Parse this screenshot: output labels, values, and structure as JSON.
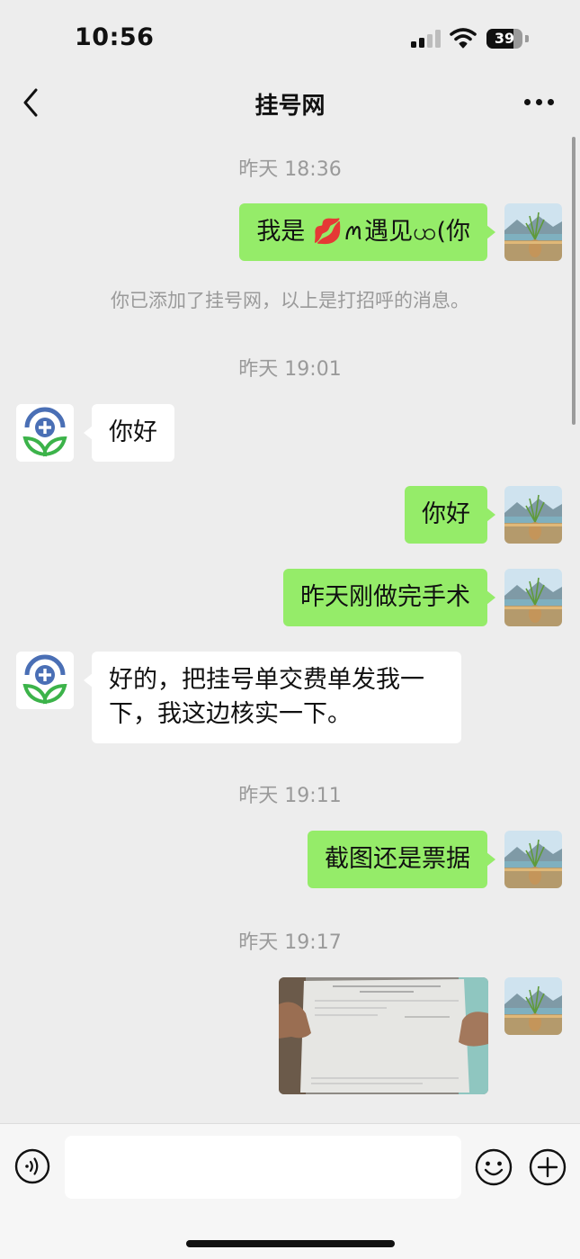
{
  "status_bar": {
    "time": "10:56",
    "battery": "39"
  },
  "nav": {
    "title": "挂号网"
  },
  "messages": [
    {
      "type": "timestamp",
      "text": "昨天 18:36"
    },
    {
      "type": "sent",
      "text": "我是 💋ꪔ遇见ꩤ(你"
    },
    {
      "type": "system",
      "text": "你已添加了挂号网，以上是打招呼的消息。"
    },
    {
      "type": "timestamp",
      "text": "昨天 19:01"
    },
    {
      "type": "received",
      "text": "你好"
    },
    {
      "type": "sent",
      "text": "你好"
    },
    {
      "type": "sent",
      "text": "昨天刚做完手术"
    },
    {
      "type": "received",
      "lines": [
        "好的，把挂号单交费单发我一",
        "下，我这边核实一下。"
      ]
    },
    {
      "type": "timestamp",
      "text": "昨天 19:11"
    },
    {
      "type": "sent",
      "text": "截图还是票据"
    },
    {
      "type": "timestamp",
      "text": "昨天 19:17"
    },
    {
      "type": "sent_image",
      "description_icon": "receipt-photo"
    }
  ],
  "input": {
    "value": "",
    "placeholder": ""
  },
  "icons": {
    "back": "chevron-left-icon",
    "more": "more-dots-icon",
    "voice": "voice-icon",
    "emoji": "emoji-icon",
    "plus": "plus-circle-icon"
  },
  "colors": {
    "background": "#ededed",
    "sent_bubble": "#95ec69",
    "received_bubble": "#ffffff",
    "timestamp_text": "#9a9a9a",
    "logo_blue": "#4a6fb5",
    "logo_green": "#3cb34a"
  }
}
